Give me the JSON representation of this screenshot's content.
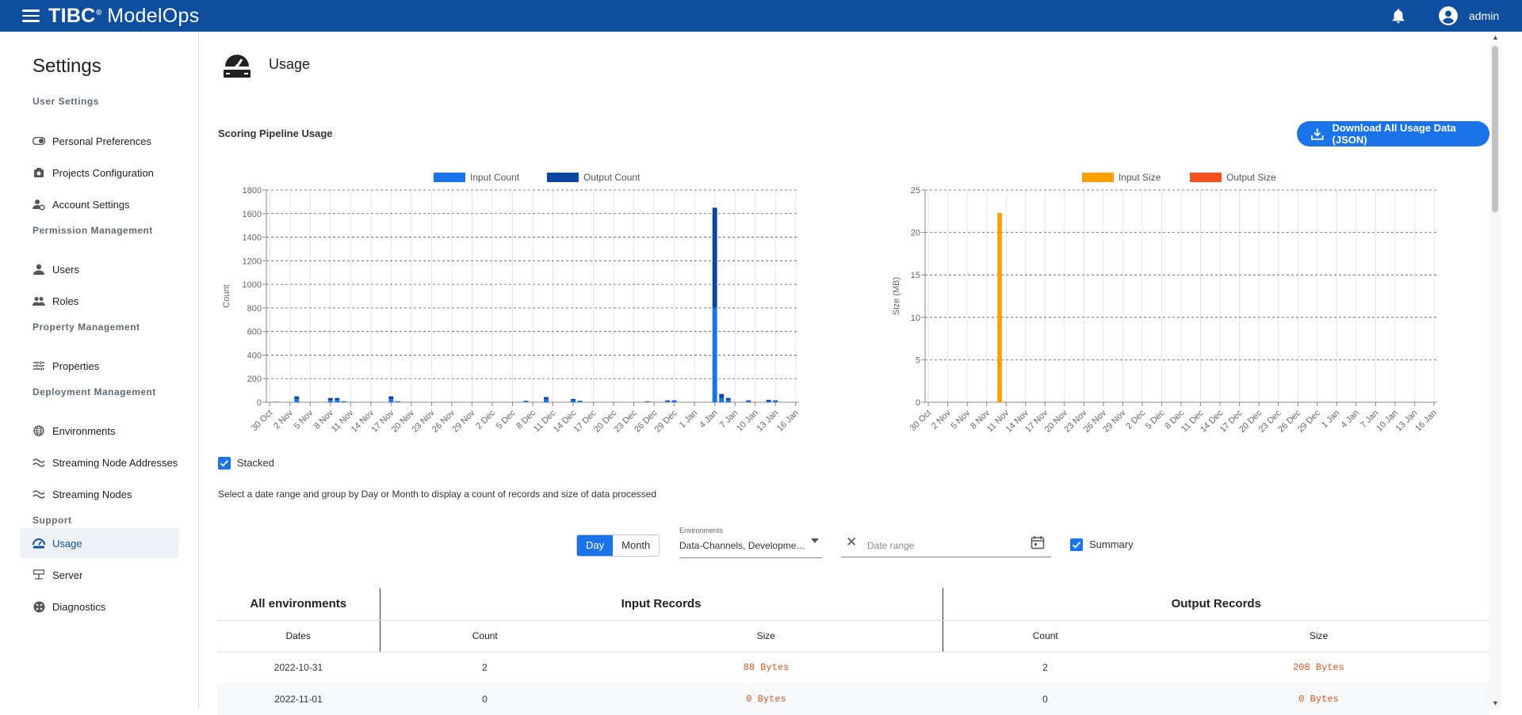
{
  "header": {
    "brand": "TIBC",
    "brand_suffix": "ModelOps",
    "user": "admin"
  },
  "sidebar": {
    "title": "Settings",
    "sections": [
      {
        "label": "User Settings"
      },
      {
        "label": "Permission Management"
      },
      {
        "label": "Property Management"
      },
      {
        "label": "Deployment Management"
      },
      {
        "label": "Support"
      }
    ],
    "items": [
      {
        "label": "Personal Preferences",
        "icon": "toggle-icon"
      },
      {
        "label": "Projects Configuration",
        "icon": "camera-icon"
      },
      {
        "label": "Account Settings",
        "icon": "account-settings-icon"
      },
      {
        "label": "Users",
        "icon": "person-icon"
      },
      {
        "label": "Roles",
        "icon": "group-icon"
      },
      {
        "label": "Properties",
        "icon": "tune-icon"
      },
      {
        "label": "Environments",
        "icon": "globe-icon"
      },
      {
        "label": "Streaming Node Addresses",
        "icon": "wave-icon"
      },
      {
        "label": "Streaming Nodes",
        "icon": "wave-icon"
      },
      {
        "label": "Usage",
        "icon": "speedometer-icon",
        "active": true
      },
      {
        "label": "Server",
        "icon": "server-icon"
      },
      {
        "label": "Diagnostics",
        "icon": "diagnostics-icon"
      }
    ]
  },
  "page": {
    "title": "Usage",
    "section_title": "Scoring Pipeline Usage",
    "download_button": "Download All Usage Data (JSON)",
    "stacked_label": "Stacked",
    "hint": "Select a date range and group by Day or Month to display a count of records and size of data processed",
    "toggle": {
      "day": "Day",
      "month": "Month"
    },
    "environments": {
      "label": "Environments",
      "value": "Data-Channels, Developme..."
    },
    "date_range_placeholder": "Date range",
    "summary_label": "Summary"
  },
  "colors": {
    "header_bg": "#0d4f9e",
    "input_count": "#1a73e8",
    "output_count": "#0d47a1",
    "input_size": "#ffa000",
    "output_size": "#f4511e"
  },
  "chart_data": [
    {
      "type": "bar",
      "stacked": true,
      "x_tick_labels": [
        "30 Oct",
        "2 Nov",
        "5 Nov",
        "8 Nov",
        "11 Nov",
        "14 Nov",
        "17 Nov",
        "20 Nov",
        "23 Nov",
        "26 Nov",
        "29 Nov",
        "2 Dec",
        "5 Dec",
        "8 Dec",
        "11 Dec",
        "14 Dec",
        "17 Dec",
        "20 Dec",
        "23 Dec",
        "26 Dec",
        "29 Dec",
        "1 Jan",
        "4 Jan",
        "7 Jan",
        "10 Jan",
        "13 Jan",
        "16 Jan"
      ],
      "dates": [
        "2022-10-31",
        "2022-11-03",
        "2022-11-08",
        "2022-11-09",
        "2022-11-10",
        "2022-11-17",
        "2022-11-18",
        "2022-12-07",
        "2022-12-10",
        "2022-12-14",
        "2022-12-15",
        "2022-12-25",
        "2022-12-28",
        "2022-12-29",
        "2023-01-04",
        "2023-01-05",
        "2023-01-06",
        "2023-01-09",
        "2023-01-12",
        "2023-01-13"
      ],
      "series": [
        {
          "name": "Input Count",
          "values": [
            2,
            25,
            18,
            18,
            4,
            25,
            4,
            6,
            22,
            14,
            6,
            4,
            8,
            8,
            800,
            35,
            18,
            8,
            10,
            8
          ]
        },
        {
          "name": "Output Count",
          "values": [
            2,
            25,
            18,
            18,
            4,
            25,
            4,
            6,
            22,
            14,
            6,
            4,
            8,
            8,
            850,
            35,
            18,
            8,
            10,
            8
          ]
        }
      ],
      "ylabel": "Count",
      "ylim": [
        0,
        1800
      ],
      "yticks": [
        0,
        200,
        400,
        600,
        800,
        1000,
        1200,
        1400,
        1600,
        1800
      ],
      "grid": true,
      "legend": "top"
    },
    {
      "type": "bar",
      "stacked": true,
      "x_tick_labels": [
        "30 Oct",
        "2 Nov",
        "5 Nov",
        "8 Nov",
        "11 Nov",
        "14 Nov",
        "17 Nov",
        "20 Nov",
        "23 Nov",
        "26 Nov",
        "29 Nov",
        "2 Dec",
        "5 Dec",
        "8 Dec",
        "11 Dec",
        "14 Dec",
        "17 Dec",
        "20 Dec",
        "23 Dec",
        "26 Dec",
        "29 Dec",
        "1 Jan",
        "4 Jan",
        "7 Jan",
        "10 Jan",
        "13 Jan",
        "16 Jan"
      ],
      "dates": [
        "2022-11-10"
      ],
      "series": [
        {
          "name": "Input Size",
          "values": [
            22.3
          ]
        },
        {
          "name": "Output Size",
          "values": [
            0
          ]
        }
      ],
      "ylabel": "Size (MB)",
      "ylim": [
        0,
        25
      ],
      "yticks": [
        0,
        5,
        10,
        15,
        20,
        25
      ],
      "grid": true,
      "legend": "top"
    }
  ],
  "table": {
    "group_header": "All environments",
    "input_header": "Input Records",
    "output_header": "Output Records",
    "columns": [
      "Dates",
      "Count",
      "Size",
      "Count",
      "Size"
    ],
    "rows": [
      [
        "2022-10-31",
        "2",
        "88 Bytes",
        "2",
        "208 Bytes"
      ],
      [
        "2022-11-01",
        "0",
        "0 Bytes",
        "0",
        "0 Bytes"
      ]
    ]
  }
}
